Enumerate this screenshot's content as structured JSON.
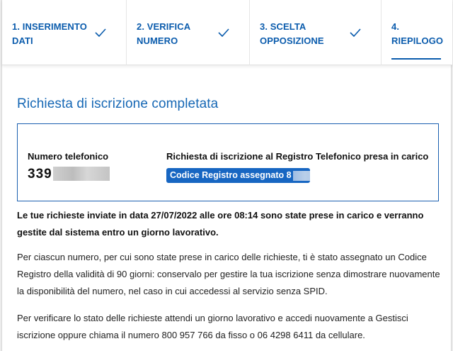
{
  "stepper": {
    "steps": [
      {
        "label": "1. INSERIMENTO\nDATI",
        "done": true
      },
      {
        "label": "2. VERIFICA\nNUMERO",
        "done": true
      },
      {
        "label": "3. SCELTA\nOPPOSIZIONE",
        "done": true
      },
      {
        "label": "4.\nRIEPILOGO",
        "done": false,
        "active": true
      }
    ]
  },
  "main": {
    "title": "Richiesta di iscrizione completata",
    "phone_label": "Numero telefonico",
    "phone_value": "339",
    "request_label": "Richiesta di iscrizione al Registro Telefonico presa in carico",
    "badge_text": "Codice Registro assegnato 8",
    "para1": "Le tue richieste inviate in data 27/07/2022 alle ore 08:14 sono state prese in carico e verranno gestite dal sistema entro un giorno lavorativo.",
    "para2": "Per ciascun numero, per cui sono state prese in carico delle richieste, ti è stato assegnato un Codice Registro della validità di 90 giorni: conservalo per gestire la tua iscrizione senza dimostrare nuovamente la disponibilità del numero, nel caso in cui accedessi al servizio senza SPID.",
    "para3": "Per verificare lo stato delle richieste attendi un giorno lavorativo e accedi nuovamente a Gestisci iscrizione oppure chiama il numero 800 957 766 da fisso o 06 4298 6411 da cellulare."
  },
  "colors": {
    "accent": "#0b5cad",
    "badge": "#1766c2",
    "title": "#1768b5"
  }
}
